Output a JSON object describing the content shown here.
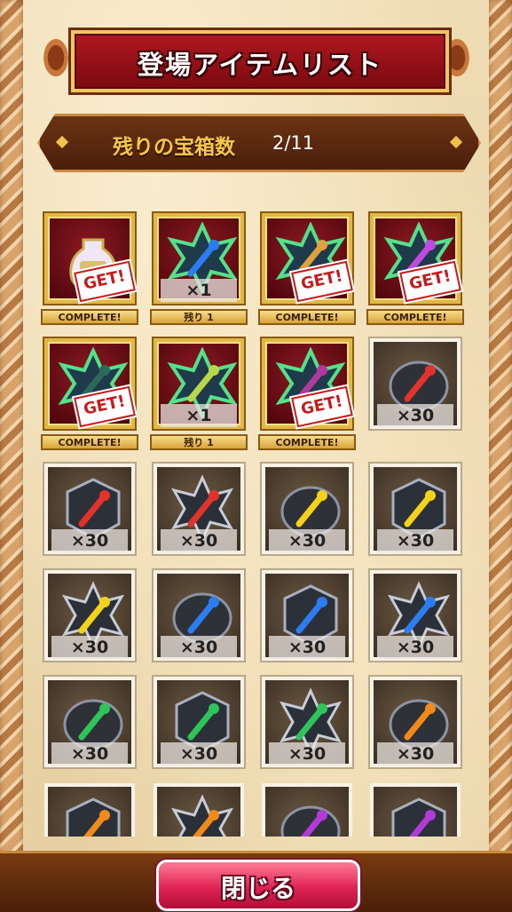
{
  "header": {
    "title": "登場アイテムリスト"
  },
  "counter": {
    "label": "残りの宝箱数",
    "value": "2/11"
  },
  "items": [
    {
      "icon": "potion-100-icon",
      "kind": "treasure",
      "qty": "",
      "get": "GET!",
      "status": "COMPLETE!"
    },
    {
      "icon": "blue-axe-star-icon",
      "kind": "treasure",
      "qty": "×1",
      "get": "",
      "status": "残り 1"
    },
    {
      "icon": "bow-star-icon",
      "kind": "treasure",
      "qty": "",
      "get": "GET!",
      "status": "COMPLETE!"
    },
    {
      "icon": "staff-star-icon",
      "kind": "treasure",
      "qty": "",
      "get": "GET!",
      "status": "COMPLETE!"
    },
    {
      "icon": "claw-star-icon",
      "kind": "treasure",
      "qty": "",
      "get": "GET!",
      "status": "COMPLETE!"
    },
    {
      "icon": "glove-star-icon",
      "kind": "treasure",
      "qty": "×1",
      "get": "",
      "status": "残り 1"
    },
    {
      "icon": "dagger-star-icon",
      "kind": "treasure",
      "qty": "",
      "get": "GET!",
      "status": "COMPLETE!"
    },
    {
      "icon": "red-bone-stone-icon",
      "kind": "normal",
      "qty": "×30",
      "get": "",
      "status": ""
    },
    {
      "icon": "red-bone-gem-icon",
      "kind": "normal",
      "qty": "×30",
      "get": "",
      "status": ""
    },
    {
      "icon": "red-bone-star-icon",
      "kind": "normal",
      "qty": "×30",
      "get": "",
      "status": ""
    },
    {
      "icon": "yellow-glove-stone-icon",
      "kind": "normal",
      "qty": "×30",
      "get": "",
      "status": ""
    },
    {
      "icon": "yellow-glove-gem-icon",
      "kind": "normal",
      "qty": "×30",
      "get": "",
      "status": ""
    },
    {
      "icon": "yellow-glove-star-icon",
      "kind": "normal",
      "qty": "×30",
      "get": "",
      "status": ""
    },
    {
      "icon": "blue-axe-stone-icon",
      "kind": "normal",
      "qty": "×30",
      "get": "",
      "status": ""
    },
    {
      "icon": "blue-axe-gem-icon",
      "kind": "normal",
      "qty": "×30",
      "get": "",
      "status": ""
    },
    {
      "icon": "blue-axe-star-icon",
      "kind": "normal",
      "qty": "×30",
      "get": "",
      "status": ""
    },
    {
      "icon": "green-arrow-stone-icon",
      "kind": "normal",
      "qty": "×30",
      "get": "",
      "status": ""
    },
    {
      "icon": "green-arrow-gem-icon",
      "kind": "normal",
      "qty": "×30",
      "get": "",
      "status": ""
    },
    {
      "icon": "green-arrow-star-icon",
      "kind": "normal",
      "qty": "×30",
      "get": "",
      "status": ""
    },
    {
      "icon": "orange-bow-stone-icon",
      "kind": "normal",
      "qty": "×30",
      "get": "",
      "status": ""
    },
    {
      "icon": "orange-bow-gem-icon",
      "kind": "normal",
      "qty": "",
      "get": "",
      "status": ""
    },
    {
      "icon": "orange-bow-star-icon",
      "kind": "normal",
      "qty": "",
      "get": "",
      "status": ""
    },
    {
      "icon": "purple-staff-stone-icon",
      "kind": "normal",
      "qty": "",
      "get": "",
      "status": ""
    },
    {
      "icon": "purple-staff-gem-icon",
      "kind": "normal",
      "qty": "",
      "get": "",
      "status": ""
    }
  ],
  "footer": {
    "close_label": "閉じる"
  },
  "colors": {
    "treasure_frame": "#e2b746",
    "close_button": "#e02455",
    "counter_text": "#f5c84a"
  }
}
